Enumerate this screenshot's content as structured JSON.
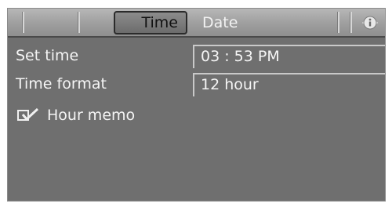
{
  "header": {
    "tabs": [
      {
        "label": "Time",
        "active": true
      },
      {
        "label": "Date",
        "active": false
      }
    ],
    "info_icon": "info-icon"
  },
  "settings": {
    "set_time": {
      "label": "Set time",
      "value": "03 : 53 PM"
    },
    "time_format": {
      "label": "Time format",
      "value": "12 hour"
    },
    "hour_memo": {
      "label": "Hour memo",
      "checked": true,
      "icon": "checkbox-checked-icon"
    }
  },
  "colors": {
    "screen_bg": "#6f6f6f",
    "header_bg": "#a6a6a6",
    "text": "#f5f5f5"
  }
}
